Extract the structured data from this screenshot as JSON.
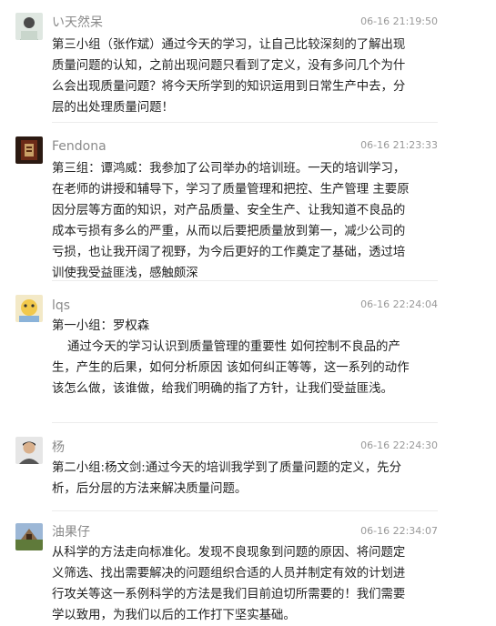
{
  "comments": [
    {
      "user": "い天然呆",
      "time": "06-16 21:19:50",
      "avatar_icon": "user-avatar-icon",
      "text": "第三小组（张作斌）通过今天的学习，让自己比较深刻的了解出现质量问题的认知，之前出现问题只看到了定义，没有多问几个为什么会出现质量问题？将今天所学到的知识运用到日常生产中去，分层的出处理质量问题！"
    },
    {
      "user": "Fendona",
      "time": "06-16 21:23:33",
      "avatar_icon": "user-avatar-icon",
      "text": "第三组：谭鸿威：我参加了公司举办的培训班。一天的培训学习，在老师的讲授和辅导下，学习了质量管理和把控、生产管理 主要原因分层等方面的知识，对产品质量、安全生产、让我知道不良品的成本亏损有多么的严重，从而以后要把质量放到第一，减少公司的亏损，也让我开阔了视野，为今后更好的工作奠定了基础，透过培训使我受益匪浅，感触颇深"
    },
    {
      "user": "lqs",
      "time": "06-16 22:24:04",
      "avatar_icon": "user-avatar-icon",
      "text": "第一小组：罗权森\n    通过今天的学习认识到质量管理的重要性 如何控制不良品的产生，产生的后果，如何分析原因 该如何纠正等等，这一系列的动作该怎么做，该谁做，给我们明确的指了方针，让我们受益匪浅。"
    },
    {
      "user": "杨",
      "time": "06-16 22:24:30",
      "avatar_icon": "user-avatar-icon",
      "text": "第二小组:杨文剑:通过今天的培训我学到了质量问题的定义，先分析，后分层的方法来解决质量问题。"
    },
    {
      "user": "油果仔",
      "time": "06-16 22:34:07",
      "avatar_icon": "user-avatar-icon",
      "text": "从科学的方法走向标准化。发现不良现象到问题的原因、将问题定义筛选、找出需要解决的问题组织合适的人员并制定有效的计划进行攻关等这一系例科学的方法是我们目前迫切所需要的！我们需要学以致用，为我们以后的工作打下坚实基础。"
    }
  ]
}
